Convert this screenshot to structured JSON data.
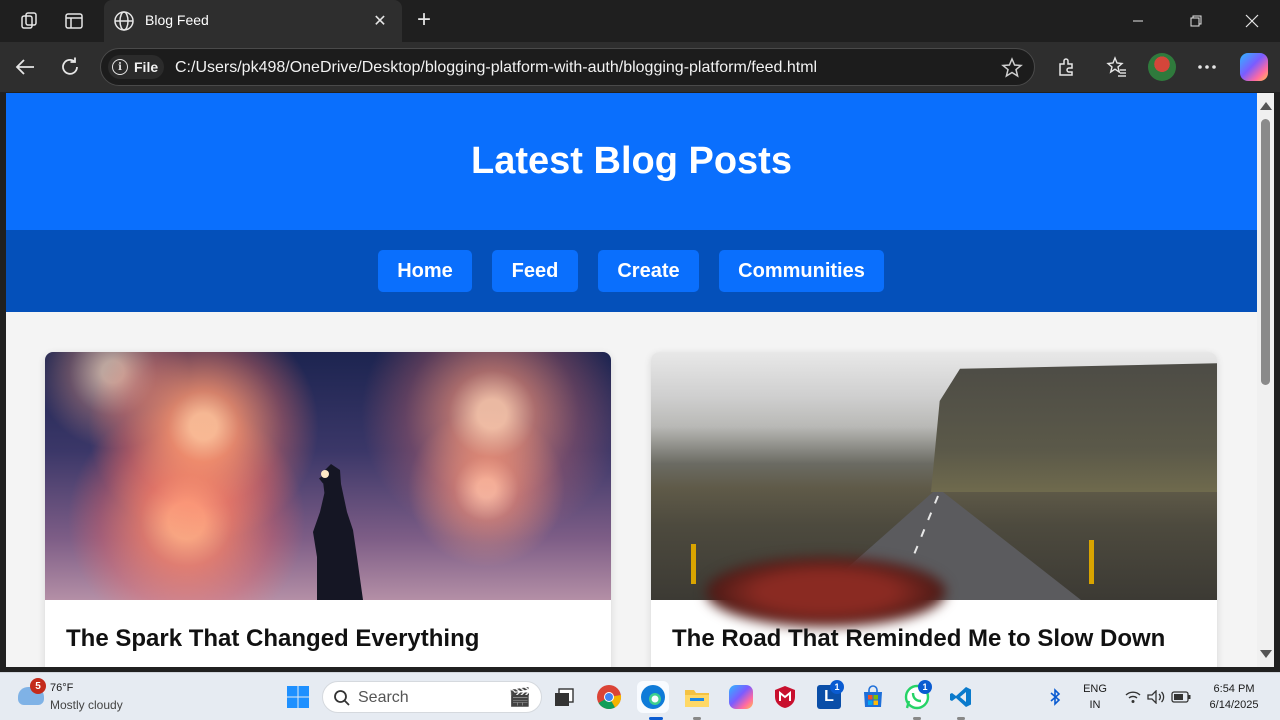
{
  "browser": {
    "tab_title": "Blog Feed",
    "address_prefix": "File",
    "url": "C:/Users/pk498/OneDrive/Desktop/blogging-platform-with-auth/blogging-platform/feed.html"
  },
  "page": {
    "heading": "Latest Blog Posts",
    "nav": {
      "home": "Home",
      "feed": "Feed",
      "create": "Create",
      "communities": "Communities"
    },
    "posts": [
      {
        "title": "The Spark That Changed Everything"
      },
      {
        "title": "The Road That Reminded Me to Slow Down"
      }
    ]
  },
  "taskbar": {
    "weather_badge": "5",
    "temperature": "76°F",
    "condition": "Mostly cloudy",
    "search_label": "Search",
    "outlook_badge": "1",
    "whatsapp_badge": "1",
    "language": "ENG",
    "region": "IN",
    "time": "6:54 PM",
    "date": "6/14/2025"
  },
  "colors": {
    "header_blue": "#0a6ffd",
    "nav_blue": "#0450ba",
    "page_bg": "#f4f4f4"
  }
}
